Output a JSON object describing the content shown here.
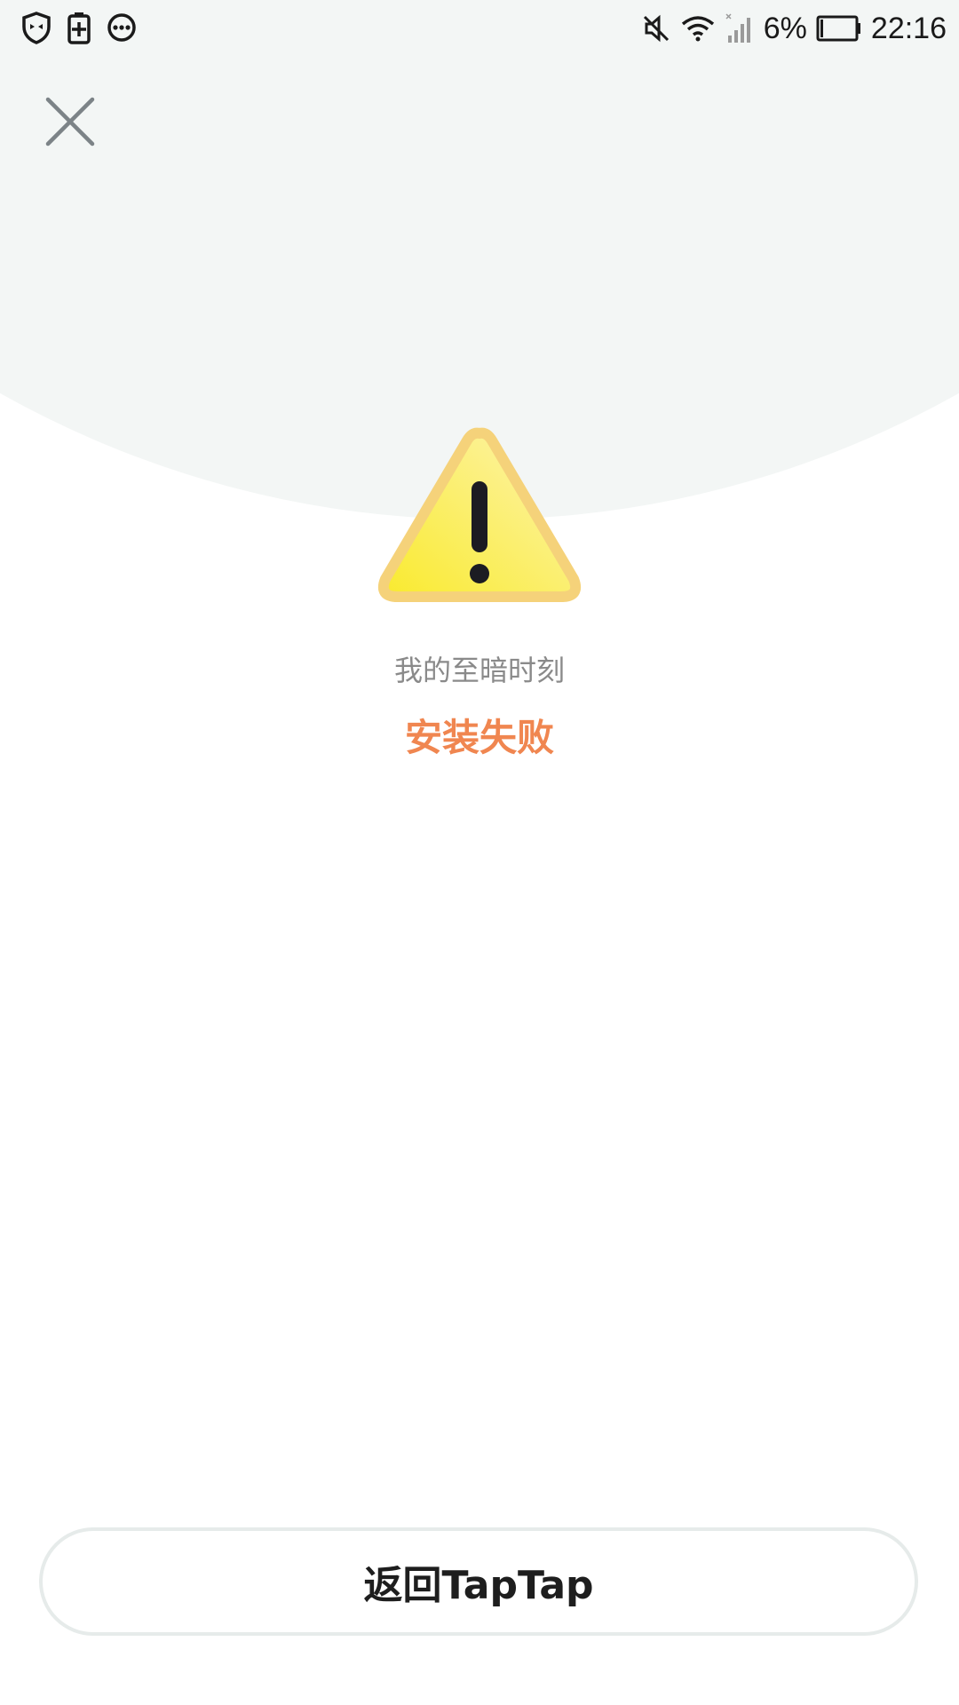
{
  "status_bar": {
    "left_icons": [
      "shield-icon",
      "battery-saver-icon",
      "more-dots-icon"
    ],
    "right_icons": [
      "mute-icon",
      "wifi-icon",
      "signal-icon",
      "battery-icon"
    ],
    "battery_percent": "6%",
    "time": "22:16"
  },
  "header": {
    "close_icon": "close-icon"
  },
  "main": {
    "status_icon": "warning-icon",
    "app_name": "我的至暗时刻",
    "status_text": "安装失败"
  },
  "footer": {
    "back_button_label": "返回TapTap"
  },
  "colors": {
    "background_top": "#f3f6f5",
    "status_text": "#f08650",
    "subtitle_text": "#8a8a8a",
    "warning_yellow": "#f7e54a",
    "warning_border": "#f5d27a"
  }
}
